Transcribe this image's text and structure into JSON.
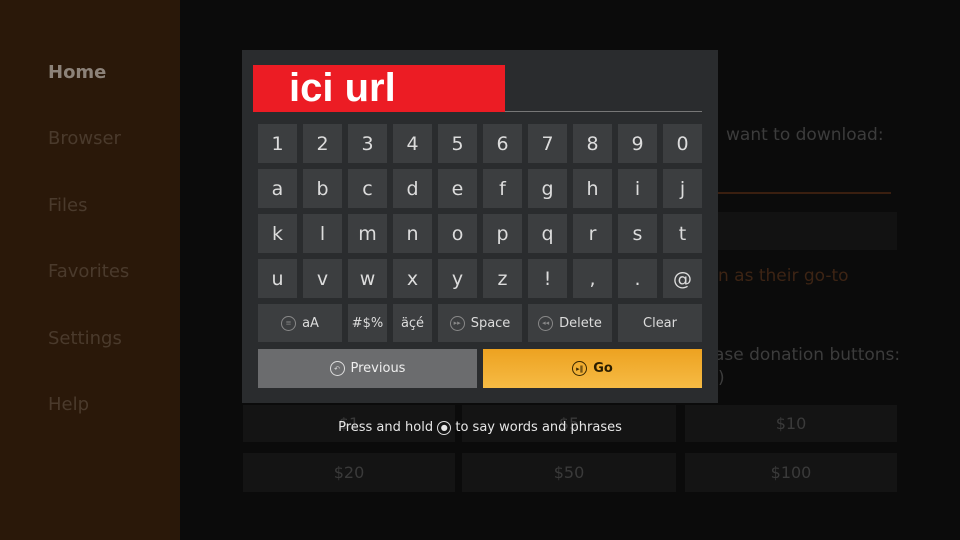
{
  "sidebar": {
    "items": [
      {
        "label": "Home",
        "active": true
      },
      {
        "label": "Browser"
      },
      {
        "label": "Files"
      },
      {
        "label": "Favorites"
      },
      {
        "label": "Settings"
      },
      {
        "label": "Help"
      }
    ]
  },
  "background": {
    "download_text": "want to download:",
    "goto_text": "n as their go-to",
    "donation_text": "ase donation buttons:",
    "paren_text": ")",
    "donations": [
      "$1",
      "$5",
      "$10",
      "$20",
      "$50",
      "$100"
    ]
  },
  "keyboard": {
    "input_value": "ici url",
    "rows": [
      [
        "1",
        "2",
        "3",
        "4",
        "5",
        "6",
        "7",
        "8",
        "9",
        "0"
      ],
      [
        "a",
        "b",
        "c",
        "d",
        "e",
        "f",
        "g",
        "h",
        "i",
        "j"
      ],
      [
        "k",
        "l",
        "m",
        "n",
        "o",
        "p",
        "q",
        "r",
        "s",
        "t"
      ],
      [
        "u",
        "v",
        "w",
        "x",
        "y",
        "z",
        "!",
        ",",
        ".",
        "@"
      ]
    ],
    "case_label": "aA",
    "symbols_label": "#$%",
    "accents_label": "äçé",
    "space_label": "Space",
    "delete_label": "Delete",
    "clear_label": "Clear",
    "previous_label": "Previous",
    "go_label": "Go",
    "hint_before": "Press and hold",
    "hint_after": "to say words and phrases"
  },
  "colors": {
    "accent": "#f0a52a",
    "url_highlight": "#ec1c24"
  }
}
